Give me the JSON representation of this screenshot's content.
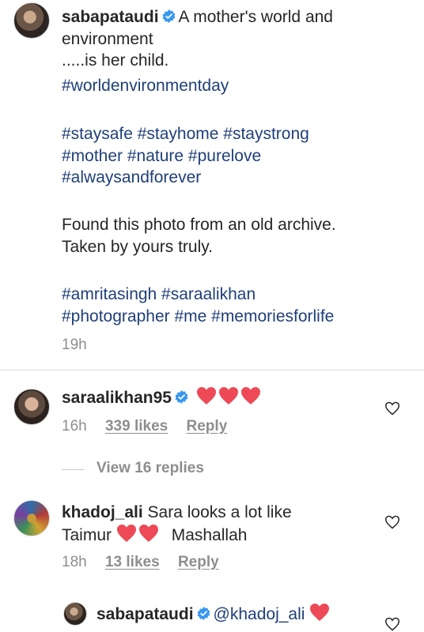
{
  "post": {
    "username": "sabapataudi",
    "caption_line1": "A mother's world and",
    "caption_line2": "environment",
    "caption_line3": ".....is her child.",
    "hashtag_line1": "#worldenvironmentday",
    "hashtag_line2": "#staysafe #stayhome #staystrong",
    "hashtag_line3": "#mother #nature #purelove",
    "hashtag_line4": "#alwaysandforever",
    "text_line1": "Found this photo from an old archive.",
    "text_line2": "Taken by yours truly.",
    "hashtag_line5": "#amritasingh #saraalikhan",
    "hashtag_line6": "#photographer #me #memoriesforlife",
    "time": "19h"
  },
  "comments": [
    {
      "username": "saraalikhan95",
      "time": "16h",
      "likes": "339 likes",
      "reply": "Reply",
      "view_replies": "View 16 replies"
    },
    {
      "username": "khadoj_ali",
      "text_line1": "Sara looks a lot like",
      "text_line2a": "Taimur",
      "text_line2b": "Mashallah",
      "time": "18h",
      "likes": "13 likes",
      "reply": "Reply"
    },
    {
      "username": "sabapataudi",
      "mention": "@khadoj_ali"
    }
  ],
  "colors": {
    "verified_badge": "#3897f0",
    "heart": "#ed4956",
    "hashtag": "#1f3f7a",
    "muted": "#8e8e8e"
  },
  "icons": [
    "verified-badge-icon",
    "heart-emoji-icon",
    "heart-outline-icon"
  ]
}
